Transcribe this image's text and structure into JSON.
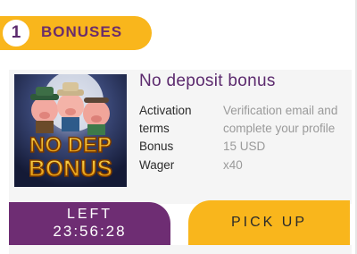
{
  "header": {
    "step_number": "1",
    "title": "BONUSES"
  },
  "bonus": {
    "image_icon": "no-deposit-bonus-pigs-artwork",
    "image_text_line1": "NO DEP",
    "image_text_line2": "BONUS",
    "title": "No deposit bonus",
    "rows": [
      {
        "label_line1": "Activation",
        "label_line2": "terms",
        "value_line1": "Verification email and",
        "value_line2": "complete your profile"
      },
      {
        "label": "Bonus",
        "value": "15 USD"
      },
      {
        "label": "Wager",
        "value": "x40"
      }
    ]
  },
  "timer": {
    "label": "LEFT",
    "time": "23:56:28"
  },
  "actions": {
    "pickup_label": "PICK UP"
  },
  "colors": {
    "accent_yellow": "#f9b61c",
    "brand_purple": "#6e2d73"
  }
}
